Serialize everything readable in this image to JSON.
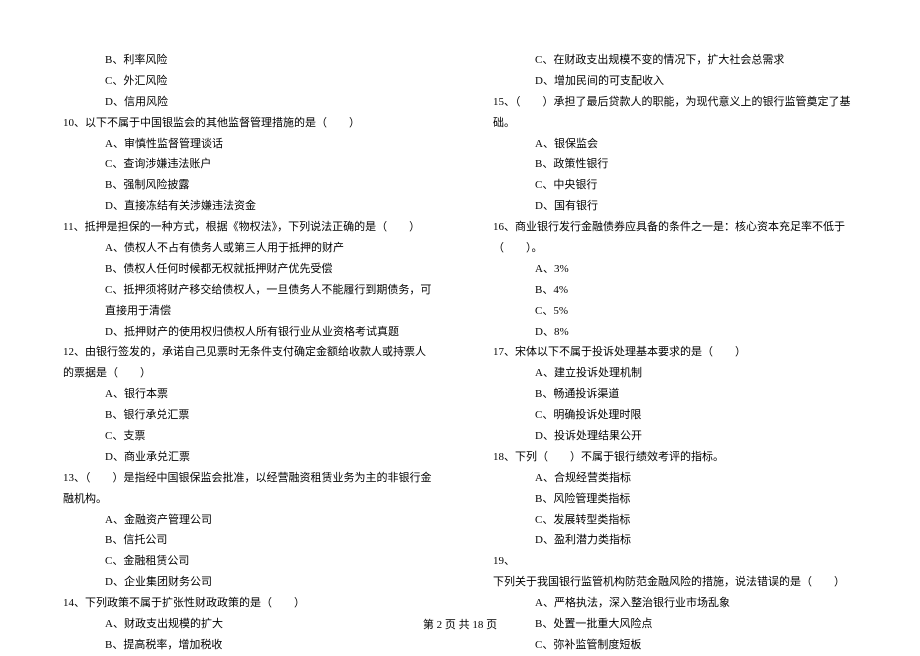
{
  "left": {
    "opts_top": [
      "B、利率风险",
      "C、外汇风险",
      "D、信用风险"
    ],
    "q10": {
      "num": "10、",
      "text": "以下不属于中国银监会的其他监督管理措施的是（　　）",
      "opts": [
        "A、审慎性监督管理谈话",
        "C、查询涉嫌违法账户",
        "B、强制风险披露",
        "D、直接冻结有关涉嫌违法资金"
      ]
    },
    "q11": {
      "num": "11、",
      "text": "抵押是担保的一种方式，根据《物权法》，下列说法正确的是（　　）",
      "opts": [
        "A、债权人不占有债务人或第三人用于抵押的财产",
        "B、债权人任何时候都无权就抵押财产优先受偿",
        "C、抵押须将财产移交给债权人，一旦债务人不能履行到期债务，可直接用于清偿",
        "D、抵押财产的使用权归债权人所有银行业从业资格考试真题"
      ]
    },
    "q12": {
      "num": "12、",
      "text": "由银行签发的，承诺自己见票时无条件支付确定金额给收款人或持票人的票据是（　　）",
      "opts": [
        "A、银行本票",
        "B、银行承兑汇票",
        "C、支票",
        "D、商业承兑汇票"
      ]
    },
    "q13": {
      "num": "13、",
      "text": "（　　）是指经中国银保监会批准，以经营融资租赁业务为主的非银行金融机构。",
      "opts": [
        "A、金融资产管理公司",
        "B、信托公司",
        "C、金融租赁公司",
        "D、企业集团财务公司"
      ]
    },
    "q14": {
      "num": "14、",
      "text": "下列政策不属于扩张性财政政策的是（　　）",
      "opts": [
        "A、财政支出规模的扩大",
        "B、提高税率，增加税收"
      ]
    }
  },
  "right": {
    "opts_top": [
      "C、在财政支出规模不变的情况下，扩大社会总需求",
      "D、增加民间的可支配收入"
    ],
    "q15": {
      "num": "15、",
      "text": "（　　）承担了最后贷款人的职能，为现代意义上的银行监管奠定了基础。",
      "opts": [
        "A、银保监会",
        "B、政策性银行",
        "C、中央银行",
        "D、国有银行"
      ]
    },
    "q16": {
      "num": "16、",
      "text": "商业银行发行金融债券应具备的条件之一是：核心资本充足率不低于（　　）。",
      "opts": [
        "A、3%",
        "B、4%",
        "C、5%",
        "D、8%"
      ]
    },
    "q17": {
      "num": "17、",
      "text": "宋体以下不属于投诉处理基本要求的是（　　）",
      "opts": [
        "A、建立投诉处理机制",
        "B、畅通投诉渠道",
        "C、明确投诉处理时限",
        "D、投诉处理结果公开"
      ]
    },
    "q18": {
      "num": "18、",
      "text": "下列（　　）不属于银行绩效考评的指标。",
      "opts": [
        "A、合规经营类指标",
        "B、风险管理类指标",
        "C、发展转型类指标",
        "D、盈利潜力类指标"
      ]
    },
    "q19": {
      "num": "19、",
      "text": "下列关于我国银行监管机构防范金融风险的措施，说法错误的是（　　）",
      "opts": [
        "A、严格执法，深入整治银行业市场乱象",
        "B、处置一批重大风险点",
        "C、弥补监管制度短板"
      ]
    }
  },
  "footer": "第 2 页 共 18 页"
}
